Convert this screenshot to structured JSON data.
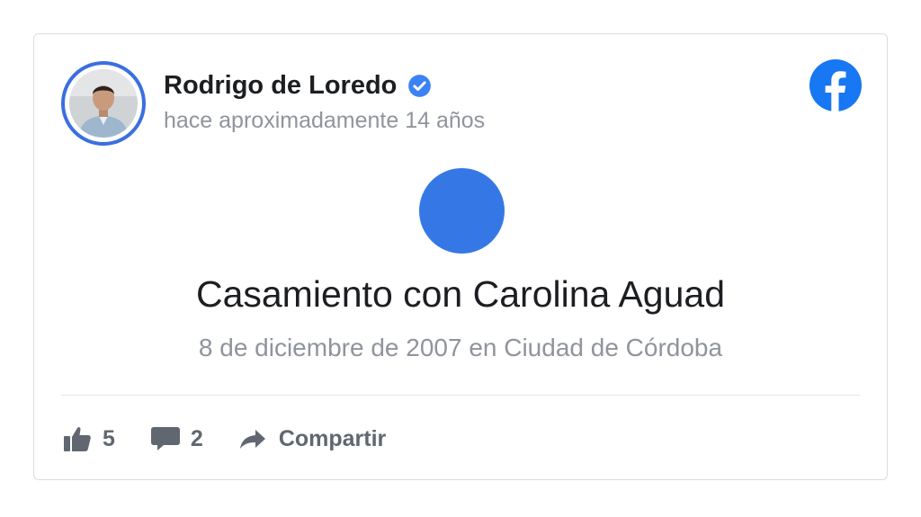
{
  "post": {
    "author": "Rodrigo de Loredo",
    "timestamp": "hace aproximadamente 14 años",
    "event_title": "Casamiento con Carolina Aguad",
    "event_subtitle": "8 de diciembre de 2007 en Ciudad de Córdoba",
    "verified": true
  },
  "actions": {
    "like_count": "5",
    "comment_count": "2",
    "share_label": "Compartir"
  },
  "icons": {
    "verified": "verified-badge-icon",
    "platform": "facebook-logo-icon",
    "like": "thumbs-up-icon",
    "comment": "speech-bubble-icon",
    "share": "share-arrow-icon"
  },
  "colors": {
    "accent": "#3578e5",
    "avatar_ring": "#3b6fe0",
    "facebook_blue": "#1877f2",
    "text_primary": "#1c1e21",
    "text_secondary": "#90949c",
    "action_text": "#606770"
  }
}
